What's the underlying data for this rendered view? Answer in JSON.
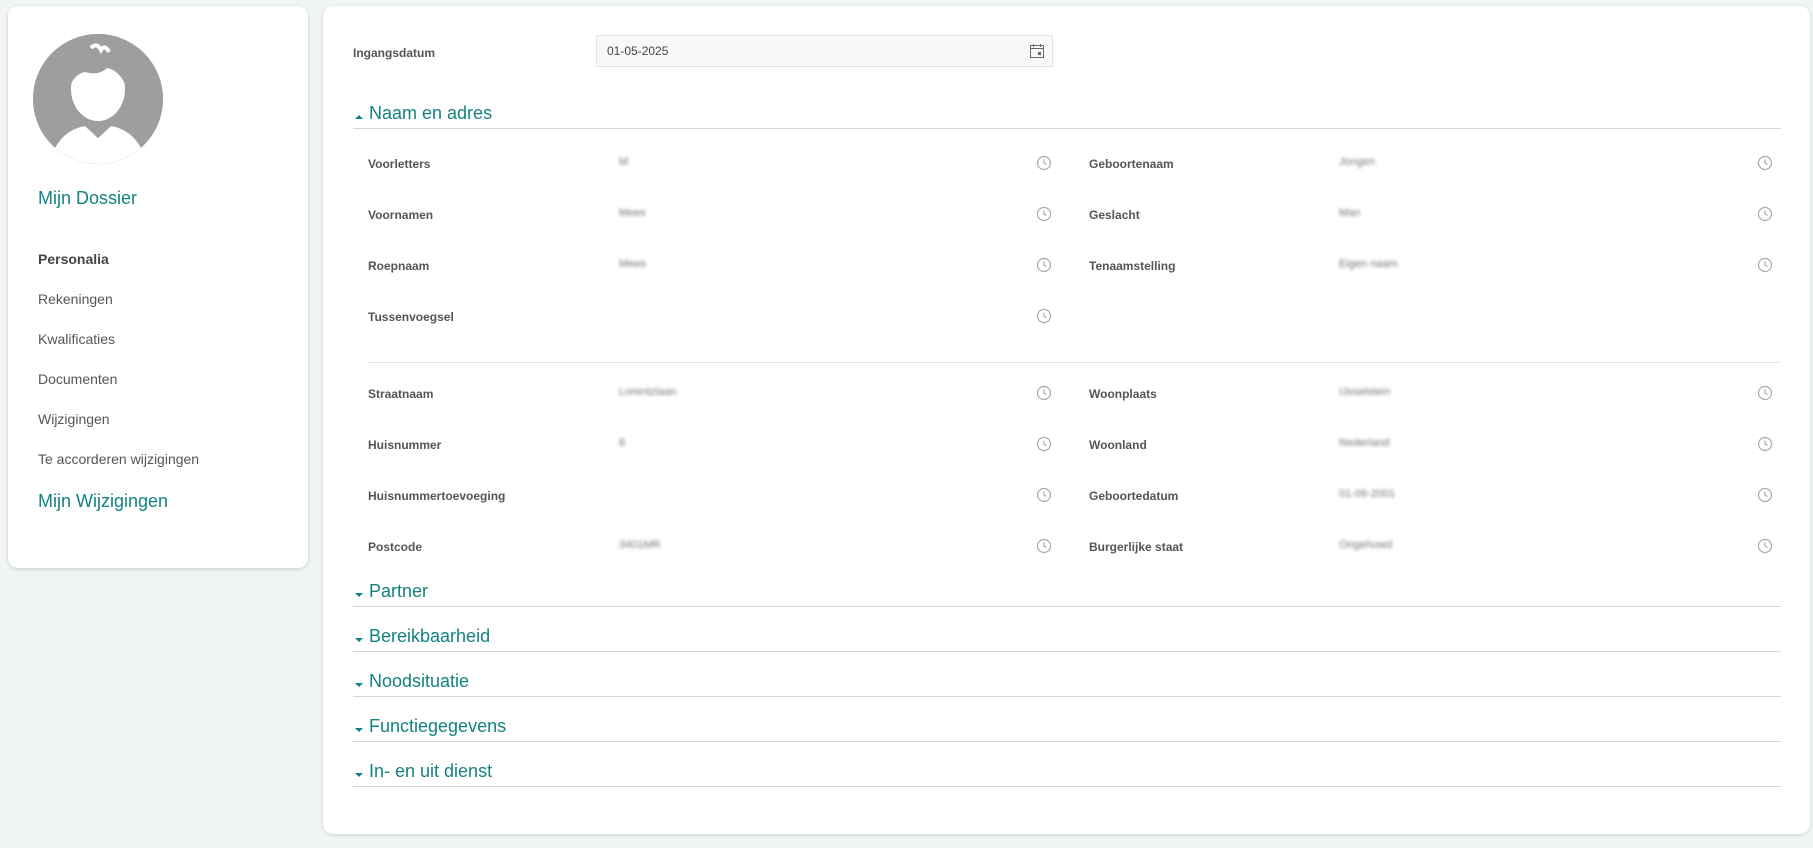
{
  "sidebar": {
    "title": "Mijn Dossier",
    "items": [
      {
        "label": "Personalia",
        "active": true
      },
      {
        "label": "Rekeningen"
      },
      {
        "label": "Kwalificaties"
      },
      {
        "label": "Documenten"
      },
      {
        "label": "Wijzigingen"
      },
      {
        "label": "Te accorderen wijzigingen"
      }
    ],
    "second_title": "Mijn Wijzigingen"
  },
  "main": {
    "ingangsdatum_label": "Ingangsdatum",
    "ingangsdatum_value": "01-05-2025",
    "sections": {
      "naam_en_adres": "Naam en adres",
      "partner": "Partner",
      "bereikbaarheid": "Bereikbaarheid",
      "noodsituatie": "Noodsituatie",
      "functiegegevens": "Functiegegevens",
      "in_en_uit_dienst": "In- en uit dienst"
    },
    "fields": {
      "voorletters": {
        "label": "Voorletters",
        "value": "M"
      },
      "voornamen": {
        "label": "Voornamen",
        "value": "Mees"
      },
      "roepnaam": {
        "label": "Roepnaam",
        "value": "Mees"
      },
      "tussenvoegsel": {
        "label": "Tussenvoegsel",
        "value": ""
      },
      "geboortenaam": {
        "label": "Geboortenaam",
        "value": "Jongen"
      },
      "geslacht": {
        "label": "Geslacht",
        "value": "Man"
      },
      "tenaamstelling": {
        "label": "Tenaamstelling",
        "value": "Eigen naam"
      },
      "straatnaam": {
        "label": "Straatnaam",
        "value": "Lorentzlaan"
      },
      "huisnummer": {
        "label": "Huisnummer",
        "value": "8"
      },
      "huisnummertoevoeging": {
        "label": "Huisnummertoevoeging",
        "value": ""
      },
      "postcode": {
        "label": "Postcode",
        "value": "3401MR"
      },
      "woonplaats": {
        "label": "Woonplaats",
        "value": "IJsselstein"
      },
      "woonland": {
        "label": "Woonland",
        "value": "Nederland"
      },
      "geboortedatum": {
        "label": "Geboortedatum",
        "value": "01-06-2001"
      },
      "burgerlijke_staat": {
        "label": "Burgerlijke staat",
        "value": "Ongehuwd"
      }
    }
  },
  "colors": {
    "accent": "#138281",
    "background": "#f1f6f4",
    "avatar": "#9e9e9e"
  }
}
